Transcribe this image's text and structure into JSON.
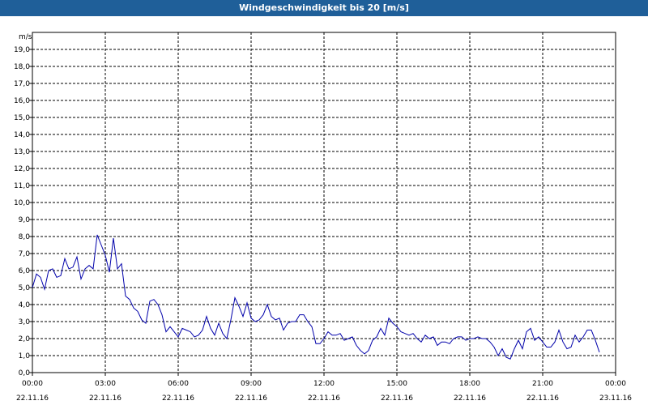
{
  "window": {
    "title": "Windgeschwindigkeit bis 20 [m/s]"
  },
  "chart_data": {
    "type": "line",
    "title": "Windgeschwindigkeit bis 20 [m/s]",
    "ylabel": "m/s",
    "xlabel": "",
    "ylim": [
      0,
      20
    ],
    "xlim_hours": [
      0,
      24
    ],
    "grid": true,
    "y_ticks": [
      "0,0",
      "1,0",
      "2,0",
      "3,0",
      "4,0",
      "5,0",
      "6,0",
      "7,0",
      "8,0",
      "9,0",
      "10,0",
      "11,0",
      "12,0",
      "13,0",
      "14,0",
      "15,0",
      "16,0",
      "17,0",
      "18,0",
      "19,0"
    ],
    "x_ticks": [
      {
        "time": "00:00",
        "date": "22.11.16"
      },
      {
        "time": "03:00",
        "date": "22.11.16"
      },
      {
        "time": "06:00",
        "date": "22.11.16"
      },
      {
        "time": "09:00",
        "date": "22.11.16"
      },
      {
        "time": "12:00",
        "date": "22.11.16"
      },
      {
        "time": "15:00",
        "date": "22.11.16"
      },
      {
        "time": "18:00",
        "date": "22.11.16"
      },
      {
        "time": "21:00",
        "date": "22.11.16"
      },
      {
        "time": "00:00",
        "date": "23.11.16"
      }
    ],
    "colors": {
      "line": "#0000aa",
      "grid": "#000000",
      "title_bar": "#1f5f99"
    },
    "x": [
      "00:00",
      "00:10",
      "00:20",
      "00:30",
      "00:40",
      "00:50",
      "01:00",
      "01:10",
      "01:20",
      "01:30",
      "01:40",
      "01:50",
      "02:00",
      "02:10",
      "02:20",
      "02:30",
      "02:40",
      "02:50",
      "03:00",
      "03:10",
      "03:20",
      "03:30",
      "03:40",
      "03:50",
      "04:00",
      "04:10",
      "04:20",
      "04:30",
      "04:40",
      "04:50",
      "05:00",
      "05:10",
      "05:20",
      "05:30",
      "05:40",
      "05:50",
      "06:00",
      "06:10",
      "06:20",
      "06:30",
      "06:40",
      "06:50",
      "07:00",
      "07:10",
      "07:20",
      "07:30",
      "07:40",
      "07:50",
      "08:00",
      "08:10",
      "08:20",
      "08:30",
      "08:40",
      "08:50",
      "09:00",
      "09:10",
      "09:20",
      "09:30",
      "09:40",
      "09:50",
      "10:00",
      "10:10",
      "10:20",
      "10:30",
      "10:40",
      "10:50",
      "11:00",
      "11:10",
      "11:20",
      "11:30",
      "11:40",
      "11:50",
      "12:00",
      "12:10",
      "12:20",
      "12:30",
      "12:40",
      "12:50",
      "13:00",
      "13:10",
      "13:20",
      "13:30",
      "13:40",
      "13:50",
      "14:00",
      "14:10",
      "14:20",
      "14:30",
      "14:40",
      "14:50",
      "15:00",
      "15:10",
      "15:20",
      "15:30",
      "15:40",
      "15:50",
      "16:00",
      "16:10",
      "16:20",
      "16:30",
      "16:40",
      "16:50",
      "17:00",
      "17:10",
      "17:20",
      "17:30",
      "17:40",
      "17:50",
      "18:00",
      "18:10",
      "18:20",
      "18:30",
      "18:40",
      "18:50",
      "19:00",
      "19:10",
      "19:20",
      "19:30",
      "19:40",
      "19:50",
      "20:00",
      "20:10",
      "20:20",
      "20:30",
      "20:40",
      "20:50",
      "21:00",
      "21:10",
      "21:20",
      "21:30",
      "21:40",
      "21:50",
      "22:00",
      "22:10",
      "22:20",
      "22:30",
      "22:40",
      "22:50",
      "23:00",
      "23:10",
      "23:20",
      "23:30",
      "23:40",
      "23:50"
    ],
    "series": [
      {
        "values": [
          5.0,
          5.8,
          5.6,
          4.9,
          6.0,
          6.1,
          5.6,
          5.7,
          6.7,
          6.1,
          6.2,
          6.8,
          5.5,
          6.1,
          6.3,
          6.1,
          8.1,
          7.5,
          6.9,
          5.9,
          7.9,
          6.1,
          6.4,
          4.5,
          4.3,
          3.8,
          3.6,
          3.1,
          2.9,
          4.2,
          4.3,
          4.0,
          3.4,
          2.4,
          2.7,
          2.4,
          2.1,
          2.6,
          2.5,
          2.4,
          2.1,
          2.2,
          2.5,
          3.3,
          2.6,
          2.2,
          2.9,
          2.3,
          2.0,
          3.1,
          4.4,
          3.9,
          3.3,
          4.1,
          3.2,
          3.0,
          3.1,
          3.4,
          4.0,
          3.3,
          3.1,
          3.2,
          2.5,
          2.9,
          3.0,
          3.0,
          3.4,
          3.4,
          3.0,
          2.7,
          1.7,
          1.7,
          2.0,
          2.4,
          2.2,
          2.2,
          2.3,
          1.9,
          2.0,
          2.1,
          1.6,
          1.3,
          1.1,
          1.3,
          1.9,
          2.1,
          2.6,
          2.2,
          3.2,
          2.9,
          2.7,
          2.4,
          2.3,
          2.2,
          2.3,
          2.0,
          1.8,
          2.2,
          2.0,
          2.1,
          1.6,
          1.8,
          1.8,
          1.7,
          2.0,
          2.1,
          2.1,
          1.9,
          2.0,
          2.0,
          2.1,
          2.0,
          2.0,
          1.8,
          1.5,
          1.0,
          1.4,
          0.9,
          0.8,
          1.4,
          1.9,
          1.4,
          2.4,
          2.6,
          1.9,
          2.1,
          1.8,
          1.5,
          1.5,
          1.8,
          2.5,
          1.8,
          1.4,
          1.5,
          2.2,
          1.8,
          2.1,
          2.5,
          2.5,
          1.9,
          1.2
        ]
      }
    ]
  }
}
